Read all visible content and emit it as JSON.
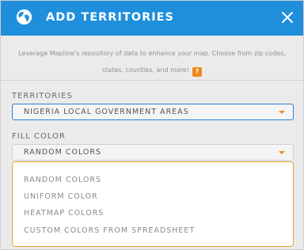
{
  "dialog": {
    "title": "ADD TERRITORIES",
    "description_line1": "Leverage Mapline's repository of data to enhance your map. Choose from zip codes,",
    "description_line2": "states, counties, and more!",
    "help_label": "?"
  },
  "territories": {
    "label": "TERRITORIES",
    "value": "NIGERIA LOCAL GOVERNMENT AREAS"
  },
  "fill_color": {
    "label": "FILL COLOR",
    "value": "RANDOM COLORS",
    "options": [
      "RANDOM COLORS",
      "UNIFORM COLOR",
      "HEATMAP COLORS",
      "CUSTOM COLORS FROM SPREADSHEET"
    ]
  },
  "icons": {
    "header": "globe-icon",
    "close": "close-icon",
    "help": "help-icon",
    "dropdown": "chevron-down-icon"
  },
  "colors": {
    "header_bg": "#1f8fdc",
    "accent": "#ef8a1a",
    "focus_border": "#2481d8"
  }
}
